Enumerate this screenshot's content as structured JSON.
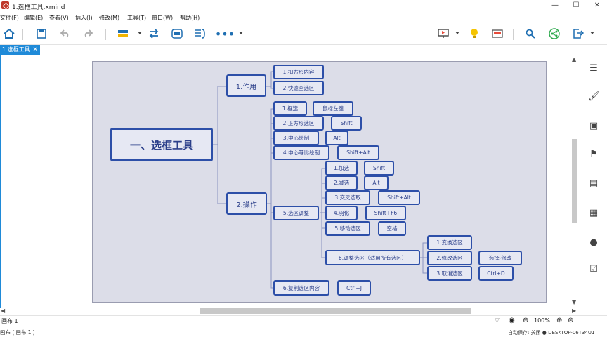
{
  "window": {
    "title": "1.选框工具.xmind",
    "minimize": "—",
    "maximize": "☐",
    "close": "✕"
  },
  "menu": [
    "文件(F)",
    "编辑(E)",
    "查看(V)",
    "插入(I)",
    "修改(M)",
    "工具(T)",
    "窗口(W)",
    "帮助(H)"
  ],
  "toolbar": {
    "icons": [
      "home-icon",
      "save-icon",
      "undo-icon",
      "redo-icon",
      "topic-icon",
      "relationship-icon",
      "boundary-icon",
      "summary-icon",
      "more-icon",
      "presentation-icon",
      "idea-icon",
      "layout-icon",
      "search-icon",
      "share-icon",
      "export-icon"
    ]
  },
  "tab": {
    "label": "1.选框工具",
    "close": "✕"
  },
  "mindmap": {
    "root": "一、选框工具",
    "branches": [
      {
        "label": "1.作用",
        "children": [
          "1.扣方形内容",
          "2.快速画选区"
        ]
      },
      {
        "label": "2.操作",
        "children": [
          {
            "label": "1.框选",
            "note": "鼠标左键"
          },
          {
            "label": "2.正方形选区",
            "note": "Shift"
          },
          {
            "label": "3.中心绘制",
            "note": "Alt"
          },
          {
            "label": "4.中心等比绘制",
            "note": "Shift+Alt"
          },
          {
            "label": "5.选区调整",
            "children": [
              {
                "label": "1.加选",
                "note": "Shift"
              },
              {
                "label": "2.减选",
                "note": "Alt"
              },
              {
                "label": "3.交叉选取",
                "note": "Shift+Alt"
              },
              {
                "label": "4.羽化",
                "note": "Shift+F6"
              },
              {
                "label": "5.移动选区",
                "note": "空格"
              },
              {
                "label": "6.调整选区（适用所有选区）",
                "children": [
                  "1.变换选区",
                  "2.修改选区",
                  "3.取消选区"
                ],
                "notes": [
                  "选择-修改",
                  "Ctrl+D"
                ]
              }
            ]
          },
          {
            "label": "6.复制选区内容",
            "note": "Ctrl+J"
          }
        ]
      }
    ]
  },
  "sheet": {
    "name": "画布 1",
    "zoom": "100%"
  },
  "status": {
    "left": "画布 ('画布 1')",
    "right": "自动保存: 关闭   ● DESKTOP-06T34U1"
  },
  "colors": {
    "accent": "#1f8ad8",
    "node_border": "#2d4fa8",
    "canvas_bg": "#dcdde8"
  }
}
